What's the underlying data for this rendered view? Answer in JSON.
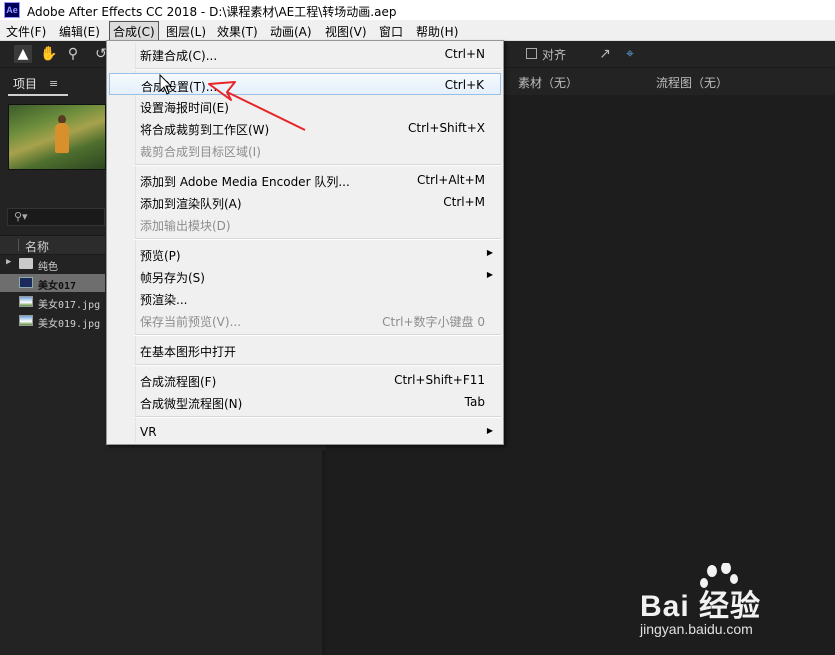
{
  "window": {
    "title": "Adobe After Effects CC 2018 - D:\\课程素材\\AE工程\\转场动画.aep",
    "app_icon": "Ae"
  },
  "menubar": [
    "文件(F)",
    "编辑(E)",
    "合成(C)",
    "图层(L)",
    "效果(T)",
    "动画(A)",
    "视图(V)",
    "窗口",
    "帮助(H)"
  ],
  "toolbar": {
    "snap_label": "对齐"
  },
  "project_panel": {
    "tab": "项目",
    "column_name": "名称",
    "items": [
      {
        "name": "纯色",
        "type": "folder"
      },
      {
        "name": "美女017",
        "type": "composition",
        "selected": true
      },
      {
        "name": "美女017.jpg",
        "type": "image"
      },
      {
        "name": "美女019.jpg",
        "type": "image"
      }
    ]
  },
  "right_tabs": {
    "footage": "素材（无）",
    "flowchart": "流程图（无）"
  },
  "comp_menu": {
    "items": [
      {
        "label": "新建合成(C)...",
        "shortcut": "Ctrl+N"
      },
      {
        "label": "合成设置(T)...",
        "shortcut": "Ctrl+K",
        "highlighted": true
      },
      {
        "label": "设置海报时间(E)",
        "shortcut": ""
      },
      {
        "label": "将合成裁剪到工作区(W)",
        "shortcut": "Ctrl+Shift+X"
      },
      {
        "label": "裁剪合成到目标区域(I)",
        "shortcut": "",
        "disabled": true
      },
      {
        "label": "添加到 Adobe Media Encoder 队列...",
        "shortcut": "Ctrl+Alt+M"
      },
      {
        "label": "添加到渲染队列(A)",
        "shortcut": "Ctrl+M"
      },
      {
        "label": "添加输出模块(D)",
        "shortcut": "",
        "disabled": true
      },
      {
        "label": "预览(P)",
        "shortcut": "",
        "submenu": true
      },
      {
        "label": "帧另存为(S)",
        "shortcut": "",
        "submenu": true
      },
      {
        "label": "预渲染...",
        "shortcut": ""
      },
      {
        "label": "保存当前预览(V)...",
        "shortcut": "Ctrl+数字小键盘 0",
        "disabled": true
      },
      {
        "label": "在基本图形中打开",
        "shortcut": ""
      },
      {
        "label": "合成流程图(F)",
        "shortcut": "Ctrl+Shift+F11"
      },
      {
        "label": "合成微型流程图(N)",
        "shortcut": "Tab"
      },
      {
        "label": "VR",
        "shortcut": "",
        "submenu": true
      }
    ]
  },
  "watermark": {
    "brand": "Bai 经验",
    "url": "jingyan.baidu.com"
  },
  "colors": {
    "accent_red": "#e8262a",
    "menu_bg": "#f0f0f0",
    "panel_bg": "#232323"
  }
}
